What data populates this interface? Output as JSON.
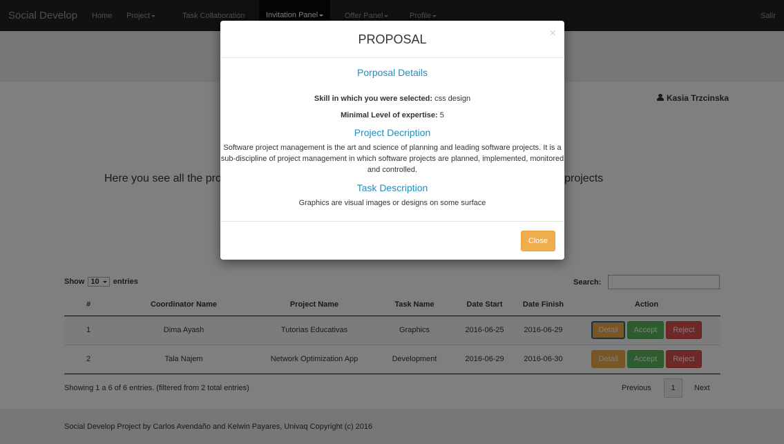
{
  "navbar": {
    "brand": "Social Develop",
    "items": [
      {
        "label": "Home"
      },
      {
        "label": "Project"
      },
      {
        "label": "Task Collaboration"
      },
      {
        "label": "Invitation Panel"
      },
      {
        "label": "Offer Panel"
      },
      {
        "label": "Profile"
      }
    ],
    "logout": "Salir"
  },
  "user": {
    "name": "Kasia Trzcinska",
    "icon": "user-icon"
  },
  "intro": "Here you see all the proposals you have received from coordinators for participating in task of projects",
  "table": {
    "length": {
      "prefix": "Show",
      "value": "10",
      "suffix": "entries"
    },
    "search_label": "Search:",
    "search_value": "",
    "columns": [
      "#",
      "Coordinator Name",
      "Project Name",
      "Task Name",
      "Date Start",
      "Date Finish",
      "Action"
    ],
    "rows": [
      {
        "num": "1",
        "coordinator": "Dima Ayash",
        "project": "Tutorias Educativas",
        "task": "Graphics",
        "start": "2016-06-25",
        "finish": "2016-06-29"
      },
      {
        "num": "2",
        "coordinator": "Tala Najem",
        "project": "Network Optimization App",
        "task": "Development",
        "start": "2016-06-29",
        "finish": "2016-06-30"
      }
    ],
    "actions": {
      "detail": "Detail",
      "accept": "Accept",
      "reject": "Reject"
    },
    "info": "Showing 1 a 6 of 6 entries. (filtered from 2 total entries)",
    "pagination": {
      "previous": "Previous",
      "page": "1",
      "next": "Next"
    }
  },
  "footer": "Social Develop Project by Carlos Avendaño and Kelwin Payares, Univaq Copyright (c) 2016",
  "modal": {
    "title": "PROPOSAL",
    "close_x": "×",
    "details_heading": "Porposal Details",
    "skill_label": "Skill in which you were selected:",
    "skill_value": "css design",
    "level_label": "Minimal Level of expertise:",
    "level_value": "5",
    "project_heading": "Project Decription",
    "project_desc": "Software project management is the art and science of planning and leading software projects. It is a sub-discipline of project management in which software projects are planned, implemented, monitored and controlled.",
    "task_heading": "Task Description",
    "task_desc": "Graphics are visual images or designs on some surface",
    "close_button": "Close"
  },
  "colors": {
    "heading_accent": "#1f8ebf",
    "warning": "#f0ad4e",
    "success": "#5cb85c",
    "danger": "#d9534f"
  }
}
